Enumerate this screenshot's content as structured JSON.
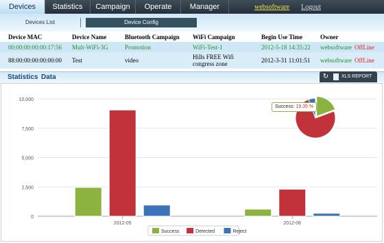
{
  "nav": {
    "tabs": [
      {
        "label": "Devices",
        "active": true
      },
      {
        "label": "Statistics",
        "active": false
      },
      {
        "label": "Campaign",
        "active": false
      },
      {
        "label": "Operate",
        "active": false
      },
      {
        "label": "Manager",
        "active": false
      }
    ],
    "user": "websoftware",
    "logout": "Logout"
  },
  "subnav": {
    "devices_list": "Devices List",
    "device_config": "Device Config"
  },
  "table": {
    "headers": [
      "Device MAC",
      "Device Name",
      "Bluetooth Campaign",
      "WiFi Campaign",
      "Begin Use Time",
      "Owner"
    ],
    "rows": [
      {
        "mac": "00:00:00:00:00:17:56",
        "name": "Mult-WiFi-3G",
        "bt": "Promotion",
        "wifi": "WiFi-Test-1",
        "time": "2012-5-18 14:35:22",
        "owner": "websoftware",
        "status": "OffLine"
      },
      {
        "mac": "88:00:00:00:00:00:00",
        "name": "Test",
        "bt": "video",
        "wifi": "Hills FREE Wifi congress zone",
        "time": "2012-3-31 11:01:51",
        "owner": "websoftware",
        "status": "OffLine"
      }
    ]
  },
  "stats": {
    "link1": "Statistics",
    "link2": "Data",
    "refresh_icon": "refresh-icon",
    "xls_icon": "xls-file-icon",
    "xls_label": "XLS REPORT"
  },
  "colors": {
    "success": "#8cb33f",
    "detected": "#c1323a",
    "reject": "#3b73b9"
  },
  "chart_data": {
    "type": "bar",
    "categories": [
      "2012-05",
      "2012-06"
    ],
    "series": [
      {
        "name": "Success",
        "values": [
          2450,
          600
        ]
      },
      {
        "name": "Detected",
        "values": [
          9050,
          2300
        ]
      },
      {
        "name": "Reject",
        "values": [
          950,
          250
        ]
      }
    ],
    "ylim": [
      0,
      10000
    ],
    "yticks": [
      "0",
      "2,500",
      "5,000",
      "7,500",
      "10,000"
    ],
    "grid": true,
    "legend": "bottom-center",
    "pie": {
      "values": {
        "Success": 19.35,
        "Detected": 75.0,
        "Reject": 5.65
      },
      "tooltip_label": "Success:",
      "tooltip_value": "19.35 %"
    }
  }
}
